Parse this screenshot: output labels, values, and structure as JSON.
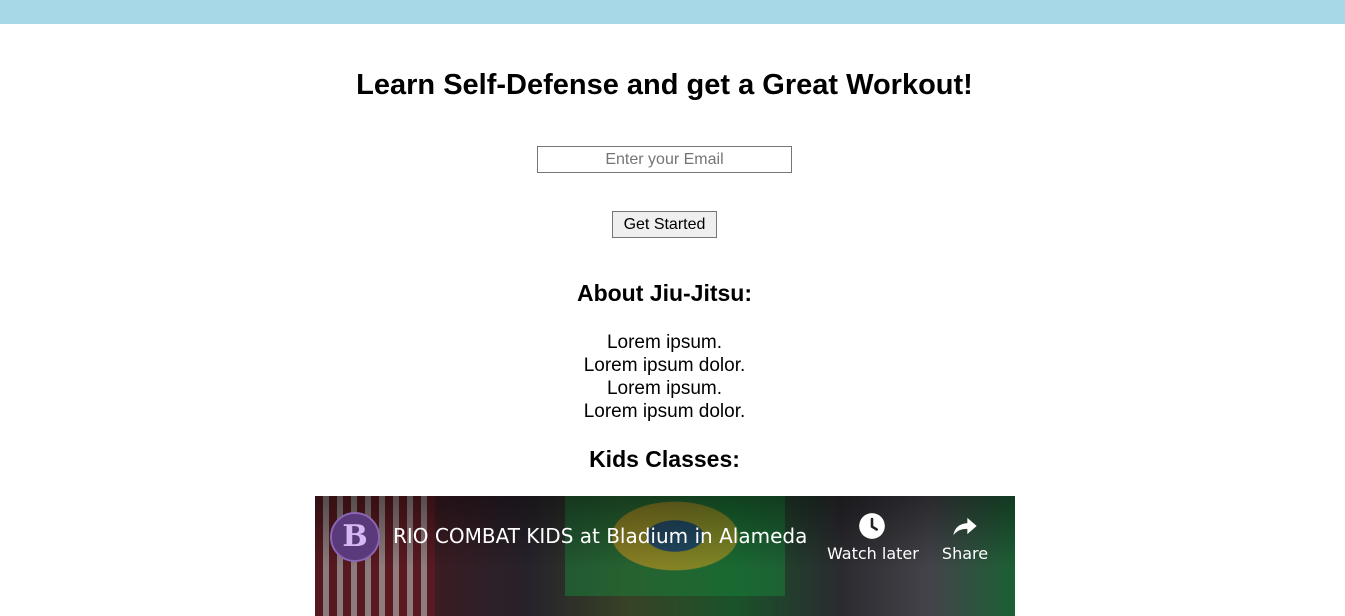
{
  "hero": {
    "title": "Learn Self-Defense and get a Great Workout!",
    "email_placeholder": "Enter your Email",
    "button_label": "Get Started"
  },
  "about": {
    "heading": "About Jiu-Jitsu:",
    "lines": [
      "Lorem ipsum.",
      "Lorem ipsum dolor.",
      "Lorem ipsum.",
      "Lorem ipsum dolor."
    ]
  },
  "kids": {
    "heading": "Kids Classes:"
  },
  "video": {
    "channel_letter": "B",
    "title": "RIO COMBAT KIDS at Bladium in Alameda",
    "watch_later_label": "Watch later",
    "share_label": "Share"
  },
  "colors": {
    "topbar": "#a6d8e7"
  }
}
